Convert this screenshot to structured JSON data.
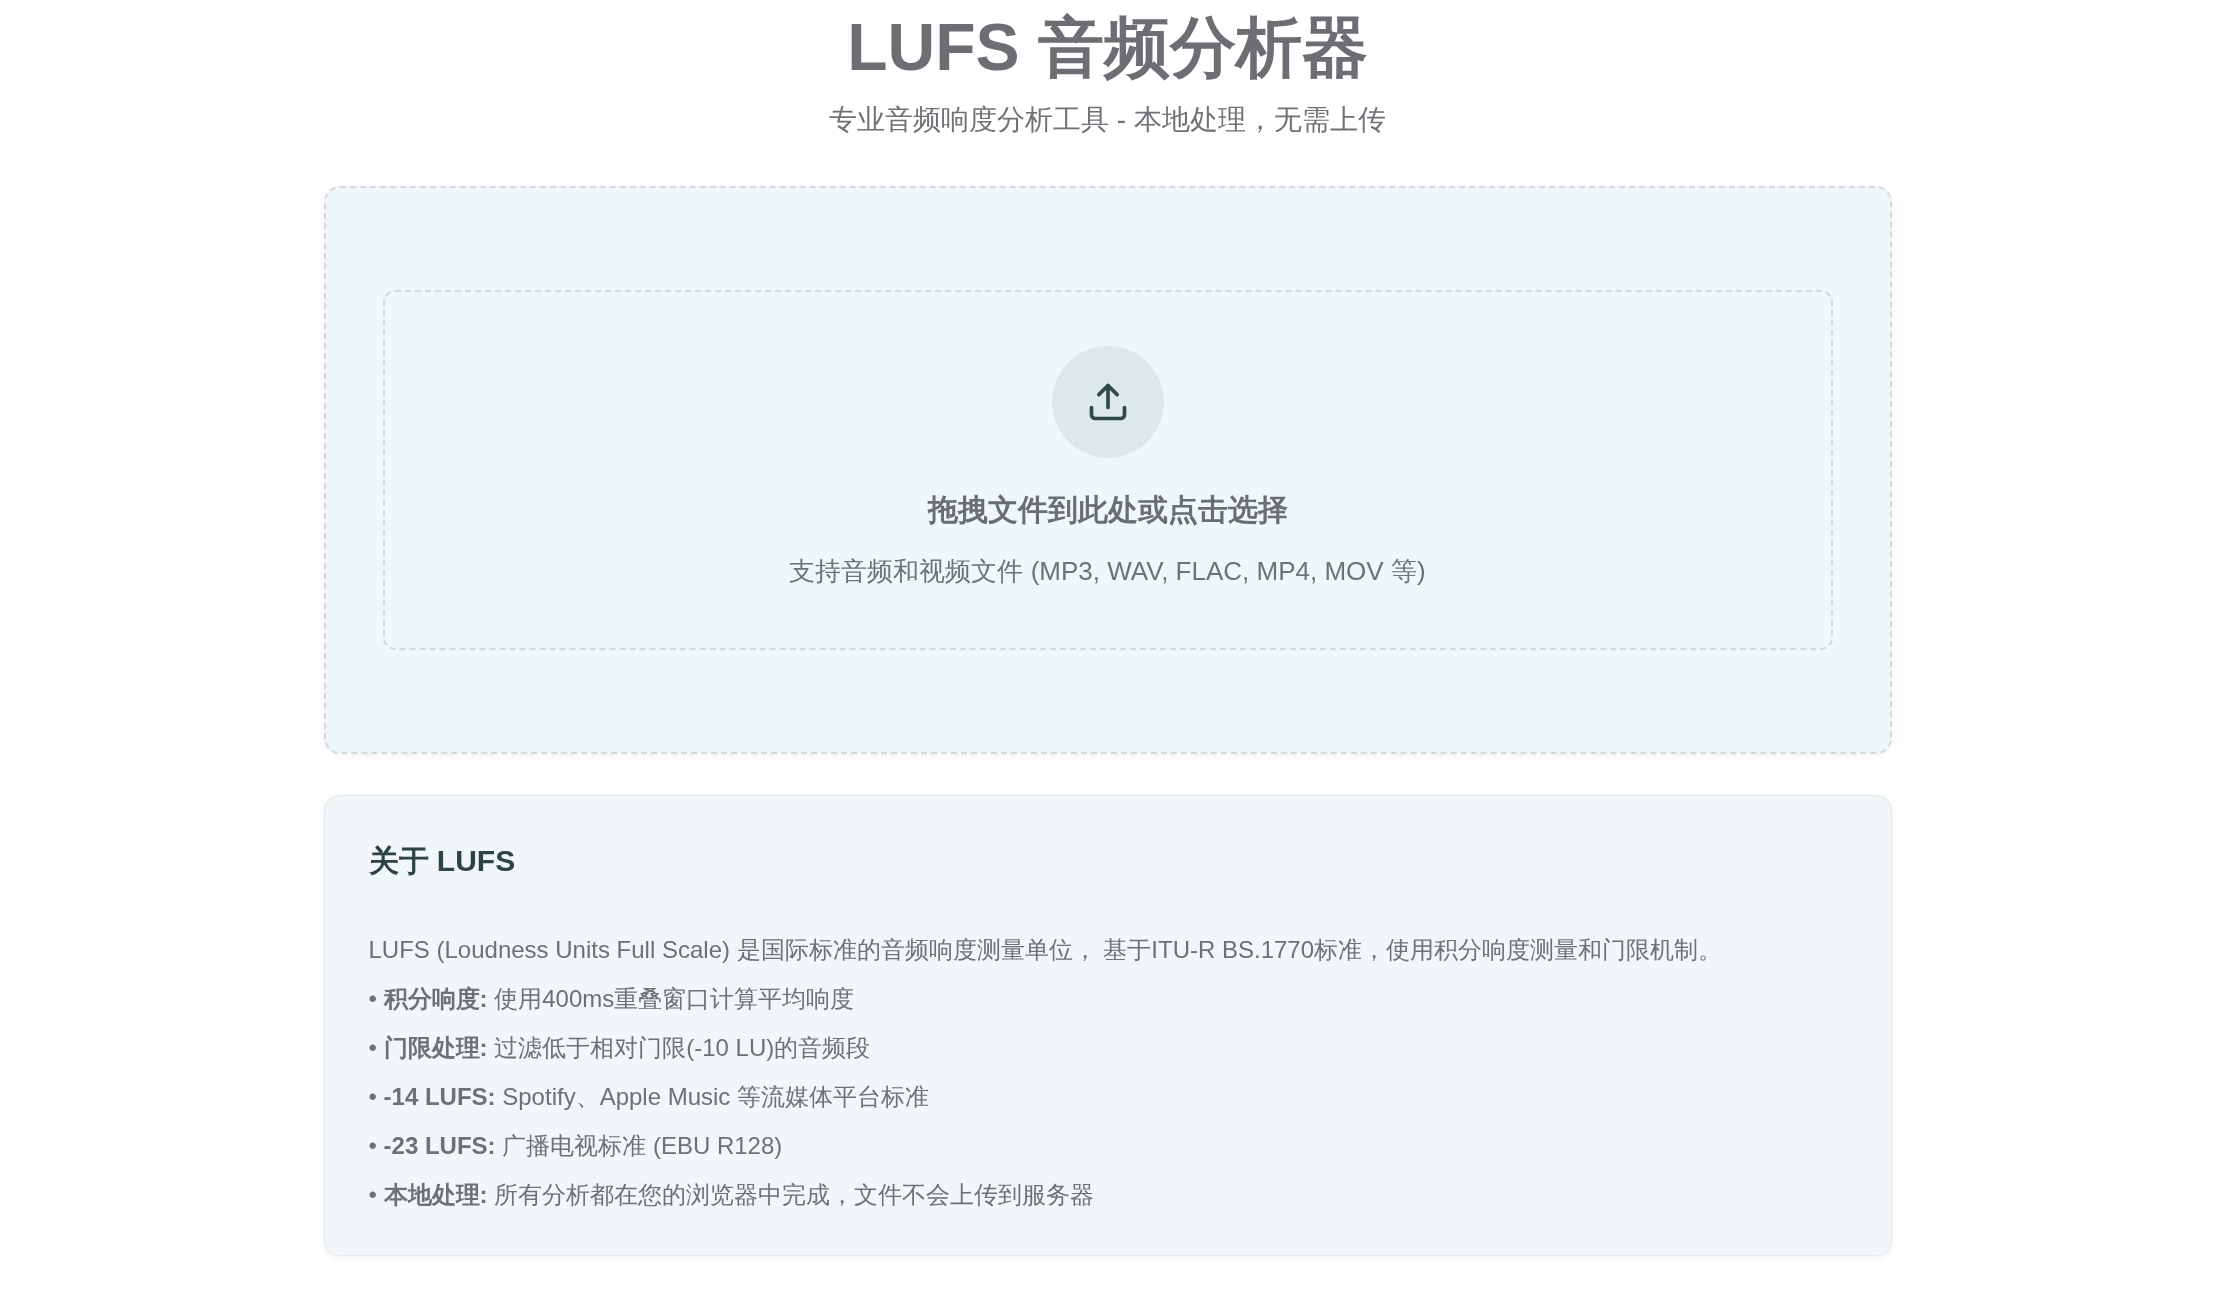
{
  "header": {
    "title": "LUFS 音频分析器",
    "subtitle": "专业音频响度分析工具 - 本地处理，无需上传"
  },
  "upload": {
    "prompt": "拖拽文件到此处或点击选择",
    "hint": "支持音频和视频文件 (MP3, WAV, FLAC, MP4, MOV 等)"
  },
  "about": {
    "title": "关于 LUFS",
    "intro": "LUFS (Loudness Units Full Scale) 是国际标准的音频响度测量单位， 基于ITU-R BS.1770标准，使用积分响度测量和门限机制。",
    "points": [
      "• **积分响度:** 使用400ms重叠窗口计算平均响度",
      "• **门限处理:** 过滤低于相对门限(-10 LU)的音频段",
      "• **-14 LUFS:** Spotify、Apple Music 等流媒体平台标准",
      "• **-23 LUFS:** 广播电视标准 (EBU R128)",
      "• **本地处理:** 所有分析都在您的浏览器中完成，文件不会上传到服务器"
    ]
  }
}
